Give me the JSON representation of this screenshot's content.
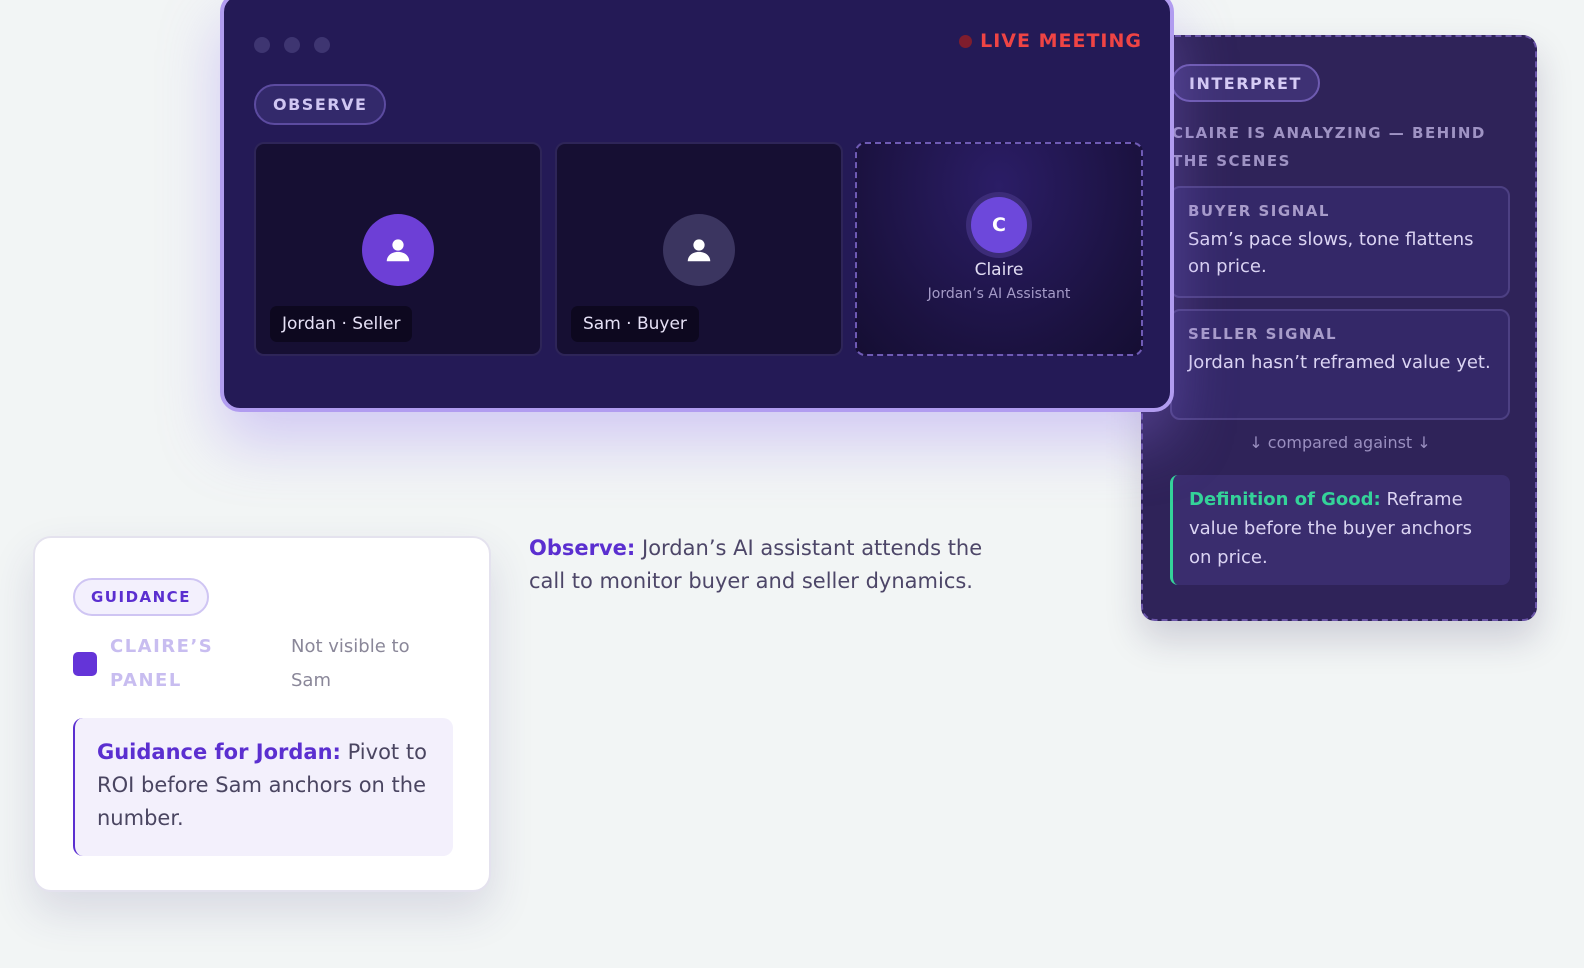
{
  "meeting": {
    "status_label": "LIVE MEETING",
    "observe_pill": "OBSERVE",
    "participants": [
      {
        "tag": "Jordan · Seller"
      },
      {
        "tag": "Sam · Buyer"
      }
    ],
    "assistant": {
      "initial": "C",
      "name": "Claire",
      "subtitle": "Jordan’s AI Assistant"
    }
  },
  "interpret": {
    "pill": "INTERPRET",
    "caption": "Claire is analyzing — behind the scenes",
    "buyer_signal": {
      "title": "BUYER SIGNAL",
      "text": "Sam’s pace slows, tone flattens on price."
    },
    "seller_signal": {
      "title": "SELLER SIGNAL",
      "text": "Jordan hasn’t reframed value yet."
    },
    "compared_label": "↓ compared against ↓",
    "definition": {
      "label": "Definition of Good:",
      "text": "Reframe value before the buyer anchors on price."
    }
  },
  "observe_caption": {
    "label": "Observe:",
    "text": "Jordan’s AI assistant attends the call to monitor buyer and seller dynamics."
  },
  "guidance": {
    "pill": "GUIDANCE",
    "panel_label": "CLAIRE’S PANEL",
    "panel_note": "Not visible to Sam",
    "box_label": "Guidance for Jordan:",
    "box_text": "Pivot to ROI before Sam anchors on the number."
  },
  "colors": {
    "accent": "#5b2fd0",
    "live": "#ef4444",
    "good": "#34d399",
    "window_bg": "#241a56",
    "panel_bg": "#2f2359"
  }
}
